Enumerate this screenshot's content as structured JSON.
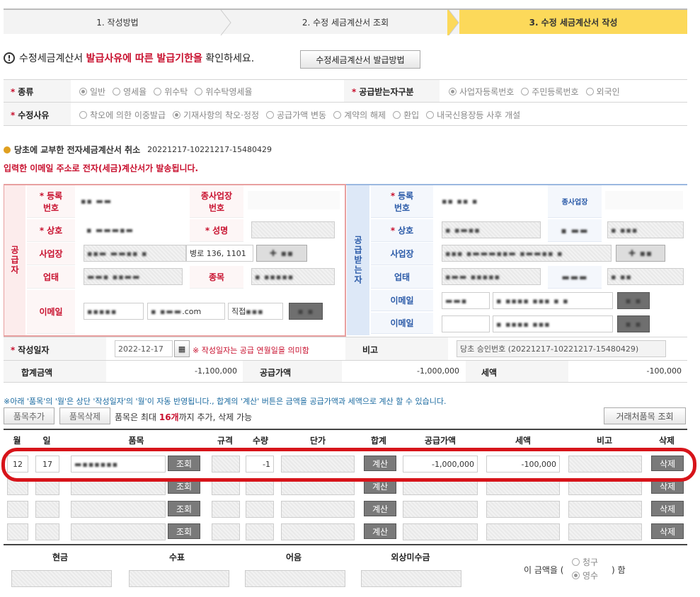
{
  "steps": [
    "1. 작성방법",
    "2. 수정 세금계산서 조회",
    "3. 수정 세금계산서 작성"
  ],
  "notice": {
    "prefix": "수정세금계산서",
    "highlight": "발급사유에 따른 발급기한을",
    "suffix": "확인하세요.",
    "button": "수정세금계산서 발급방법"
  },
  "kind": {
    "label": "종류",
    "options": [
      "일반",
      "영세율",
      "위수탁",
      "위수탁영세율"
    ],
    "selected": "일반"
  },
  "receiver_type": {
    "label": "공급받는자구분",
    "options": [
      "사업자등록번호",
      "주민등록번호",
      "외국인"
    ],
    "selected": "사업자등록번호"
  },
  "reason": {
    "label": "수정사유",
    "options": [
      "착오에 의한 이중발급",
      "기재사항의 착오·정정",
      "공급가액 변동",
      "계약의 해제",
      "환입",
      "내국신용장등 사후 개설"
    ],
    "selected": "기재사항의 착오·정정"
  },
  "cancel_line": {
    "label": "당초에 교부한 전자세금계산서 취소",
    "number": "20221217-10221217-15480429"
  },
  "email_notice": "입력한 이메일 주소로 전자(세금)계산서가 발송됩니다.",
  "supplier": {
    "title": "공급자",
    "reg_no_label": "등록\n번호",
    "sub_biz_label": "종사업장\n번호",
    "company_label": "상호",
    "name_label": "성명",
    "address_label": "사업장",
    "address_value": "병로 136, 1101",
    "biz_type_label": "업태",
    "item_label": "종목",
    "email_label": "이메일",
    "email_domain": ".com",
    "email_select": "직접"
  },
  "receiver": {
    "title": "공급받는자",
    "reg_no_label": "등록\n번호",
    "sub_biz_label": "종사업장",
    "company_label": "상호",
    "address_label": "사업장",
    "biz_type_label": "업태",
    "email_label": "이메일",
    "email_label2": "이메일"
  },
  "write_date": {
    "label": "작성일자",
    "value": "2022-12-17",
    "hint": "※ 작성일자는 공급 연월일을 의미함",
    "note_label": "비고",
    "note_value": "당초 승인번호 (20221217-10221217-15480429)"
  },
  "totals": {
    "total_label": "합계금액",
    "total_value": "-1,100,000",
    "supply_label": "공급가액",
    "supply_value": "-1,000,000",
    "tax_label": "세액",
    "tax_value": "-100,000"
  },
  "grid_notice": "※아래 '품목'의 '월'은 상단 '작성일자'의 '월'이 자동 반영됩니다., 합계의 '계산' 버튼은 금액을 공급가액과 세액으로 계산 할 수 있습니다.",
  "grid_toolbar": {
    "add": "품목추가",
    "delete": "품목삭제",
    "info_prefix": "품목은 최대",
    "info_count": "16개",
    "info_suffix": "까지 추가, 삭제 가능",
    "partner": "거래처품목 조회"
  },
  "grid_headers": [
    "월",
    "일",
    "품목",
    "규격",
    "수량",
    "단가",
    "합계",
    "공급가액",
    "세액",
    "비고",
    "삭제"
  ],
  "row1": {
    "month": "12",
    "day": "17",
    "qty": "-1",
    "supply": "-1,000,000",
    "tax": "-100,000"
  },
  "row_buttons": {
    "lookup": "조회",
    "calc": "계산",
    "delete": "삭제"
  },
  "payment": {
    "headers": [
      "현금",
      "수표",
      "어음",
      "외상미수금"
    ],
    "amount_prefix": "이 금액을 (",
    "amount_suffix": ") 함",
    "claim": "청구",
    "receipt": "영수"
  }
}
